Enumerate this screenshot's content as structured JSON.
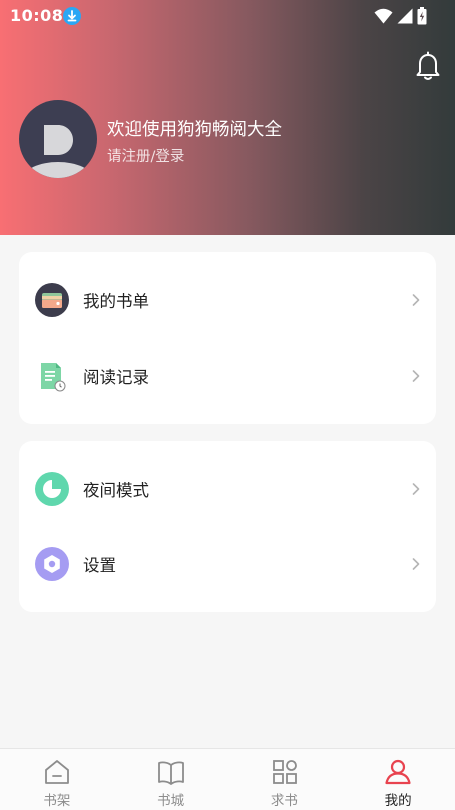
{
  "status_bar": {
    "time": "10:08"
  },
  "profile": {
    "welcome_text": "欢迎使用狗狗畅阅大全",
    "login_text": "请注册/登录"
  },
  "menu_groups": [
    [
      {
        "label": "我的书单",
        "icon": "wallet-icon"
      },
      {
        "label": "阅读记录",
        "icon": "reading-history-icon"
      }
    ],
    [
      {
        "label": "夜间模式",
        "icon": "night-mode-icon"
      },
      {
        "label": "设置",
        "icon": "settings-icon"
      }
    ]
  ],
  "tabs": [
    {
      "label": "书架",
      "icon": "home-icon",
      "active": false
    },
    {
      "label": "书城",
      "icon": "book-icon",
      "active": false
    },
    {
      "label": "求书",
      "icon": "grid-icon",
      "active": false
    },
    {
      "label": "我的",
      "icon": "user-icon",
      "active": true
    }
  ],
  "colors": {
    "accent": "#e8434f",
    "header_start": "#f86f73",
    "header_end": "#333b3b",
    "inactive_tab": "#8c8c8c"
  }
}
